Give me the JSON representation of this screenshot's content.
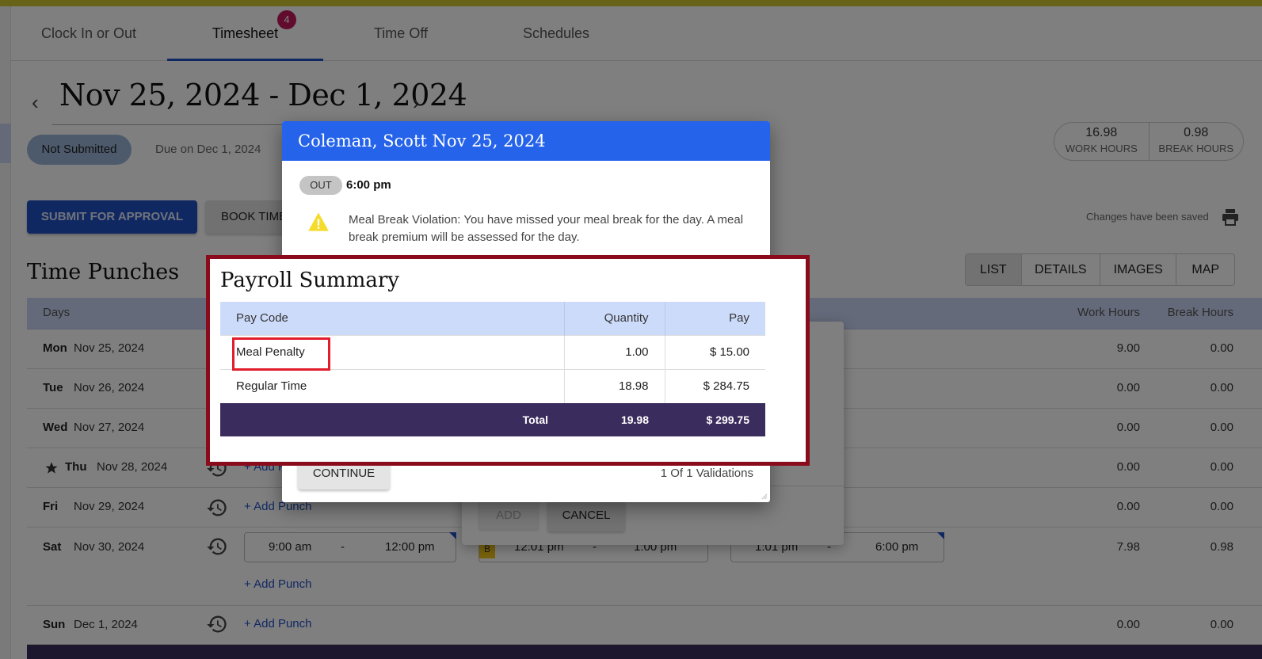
{
  "nav": {
    "tabs": [
      {
        "label": "Clock In or Out",
        "active": false
      },
      {
        "label": "Timesheet",
        "active": true,
        "badge": "4"
      },
      {
        "label": "Time Off",
        "active": false
      },
      {
        "label": "Schedules",
        "active": false
      }
    ]
  },
  "period": {
    "prev_icon": "chevron-left-icon",
    "next_icon": "chevron-right-icon",
    "title": "Nov 25, 2024 - Dec 1, 2024",
    "status": "Not Submitted",
    "due": "Due on Dec 1, 2024"
  },
  "totals": {
    "work_hours": "16.98",
    "work_label": "WORK HOURS",
    "break_hours": "0.98",
    "break_label": "BREAK HOURS"
  },
  "actions": {
    "submit": "SUBMIT FOR APPROVAL",
    "book_time": "BOOK TIME",
    "saved_status": "Changes have been saved"
  },
  "section": {
    "title": "Time Punches",
    "views": [
      "LIST",
      "DETAILS",
      "IMAGES",
      "MAP"
    ],
    "active_view": "LIST"
  },
  "grid": {
    "headers": {
      "days": "Days",
      "work": "Work Hours",
      "break": "Break Hours"
    },
    "add_punch": "+ Add Punch",
    "rows": [
      {
        "dow": "Mon",
        "date": "Nov 25, 2024",
        "work": "9.00",
        "break": "0.00"
      },
      {
        "dow": "Tue",
        "date": "Nov 26, 2024",
        "work": "0.00",
        "break": "0.00"
      },
      {
        "dow": "Wed",
        "date": "Nov 27, 2024",
        "work": "0.00",
        "break": "0.00"
      },
      {
        "dow": "Thu",
        "date": "Nov 28, 2024",
        "work": "0.00",
        "break": "0.00",
        "holiday": true
      },
      {
        "dow": "Fri",
        "date": "Nov 29, 2024",
        "work": "0.00",
        "break": "0.00"
      },
      {
        "dow": "Sat",
        "date": "Nov 30, 2024",
        "work": "7.98",
        "break": "0.98",
        "punches": [
          {
            "in": "9:00 am",
            "out": "12:00 pm",
            "sep": "-"
          },
          {
            "in": "12:01 pm",
            "out": "1:00 pm",
            "sep": "-",
            "flag": "B"
          },
          {
            "in": "1:01 pm",
            "out": "6:00 pm",
            "sep": "-"
          }
        ]
      },
      {
        "dow": "Sun",
        "date": "Dec 1, 2024",
        "work": "0.00",
        "break": "0.00"
      }
    ]
  },
  "add_dialog": {
    "add": "ADD",
    "cancel": "CANCEL"
  },
  "modal": {
    "title": "Coleman, Scott Nov 25, 2024",
    "punch_type": "OUT",
    "punch_time": "6:00 pm",
    "warning": "Meal Break Violation: You have missed your meal break for the day. A meal break premium will be assessed for the day.",
    "continue": "CONTINUE",
    "validations": "1 Of 1 Validations"
  },
  "payroll": {
    "title": "Payroll Summary",
    "columns": [
      "Pay Code",
      "Quantity",
      "Pay"
    ],
    "rows": [
      {
        "code": "Meal Penalty",
        "qty": "1.00",
        "pay": "$ 15.00",
        "highlighted": true
      },
      {
        "code": "Regular Time",
        "qty": "18.98",
        "pay": "$ 284.75"
      }
    ],
    "total": {
      "label": "Total",
      "qty": "19.98",
      "pay": "$ 299.75"
    }
  },
  "colors": {
    "accent": "#2150c5",
    "modal_header": "#2563eb",
    "badge": "#c2185b",
    "total_row": "#3b2c5e",
    "callout_border": "#8a0b1c",
    "highlight_box": "#e11d2c",
    "top_bar": "#d2c633"
  }
}
